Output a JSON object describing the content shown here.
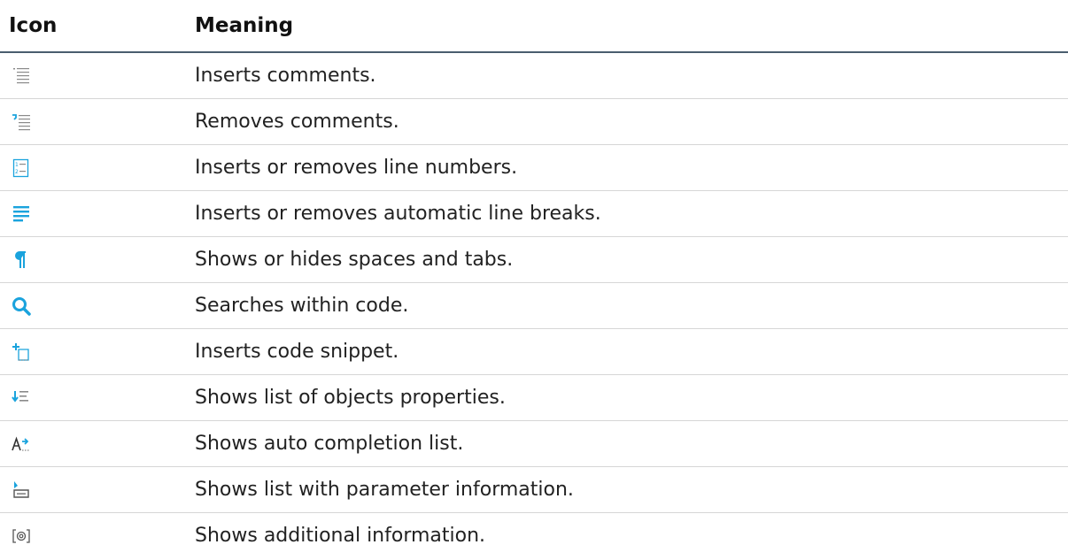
{
  "table": {
    "headers": {
      "icon": "Icon",
      "meaning": "Meaning"
    },
    "rows": [
      {
        "icon": "insert-comments-icon",
        "meaning": "Inserts comments."
      },
      {
        "icon": "remove-comments-icon",
        "meaning": "Removes comments."
      },
      {
        "icon": "line-numbers-icon",
        "meaning": "Inserts or removes line numbers."
      },
      {
        "icon": "line-breaks-icon",
        "meaning": "Inserts or removes automatic line breaks."
      },
      {
        "icon": "pilcrow-icon",
        "meaning": "Shows or hides spaces and tabs."
      },
      {
        "icon": "search-icon",
        "meaning": "Searches within code."
      },
      {
        "icon": "insert-snippet-icon",
        "meaning": "Inserts code snippet."
      },
      {
        "icon": "object-properties-icon",
        "meaning": "Shows list of objects properties."
      },
      {
        "icon": "auto-completion-icon",
        "meaning": "Shows auto completion list."
      },
      {
        "icon": "parameter-info-icon",
        "meaning": "Shows list with parameter information."
      },
      {
        "icon": "additional-info-icon",
        "meaning": "Shows additional information."
      }
    ]
  },
  "colors": {
    "icon_blue": "#1aa3dd",
    "icon_gray": "#8a8a8a",
    "header_rule": "#4a5d6e",
    "row_rule": "#d6d6d6"
  }
}
